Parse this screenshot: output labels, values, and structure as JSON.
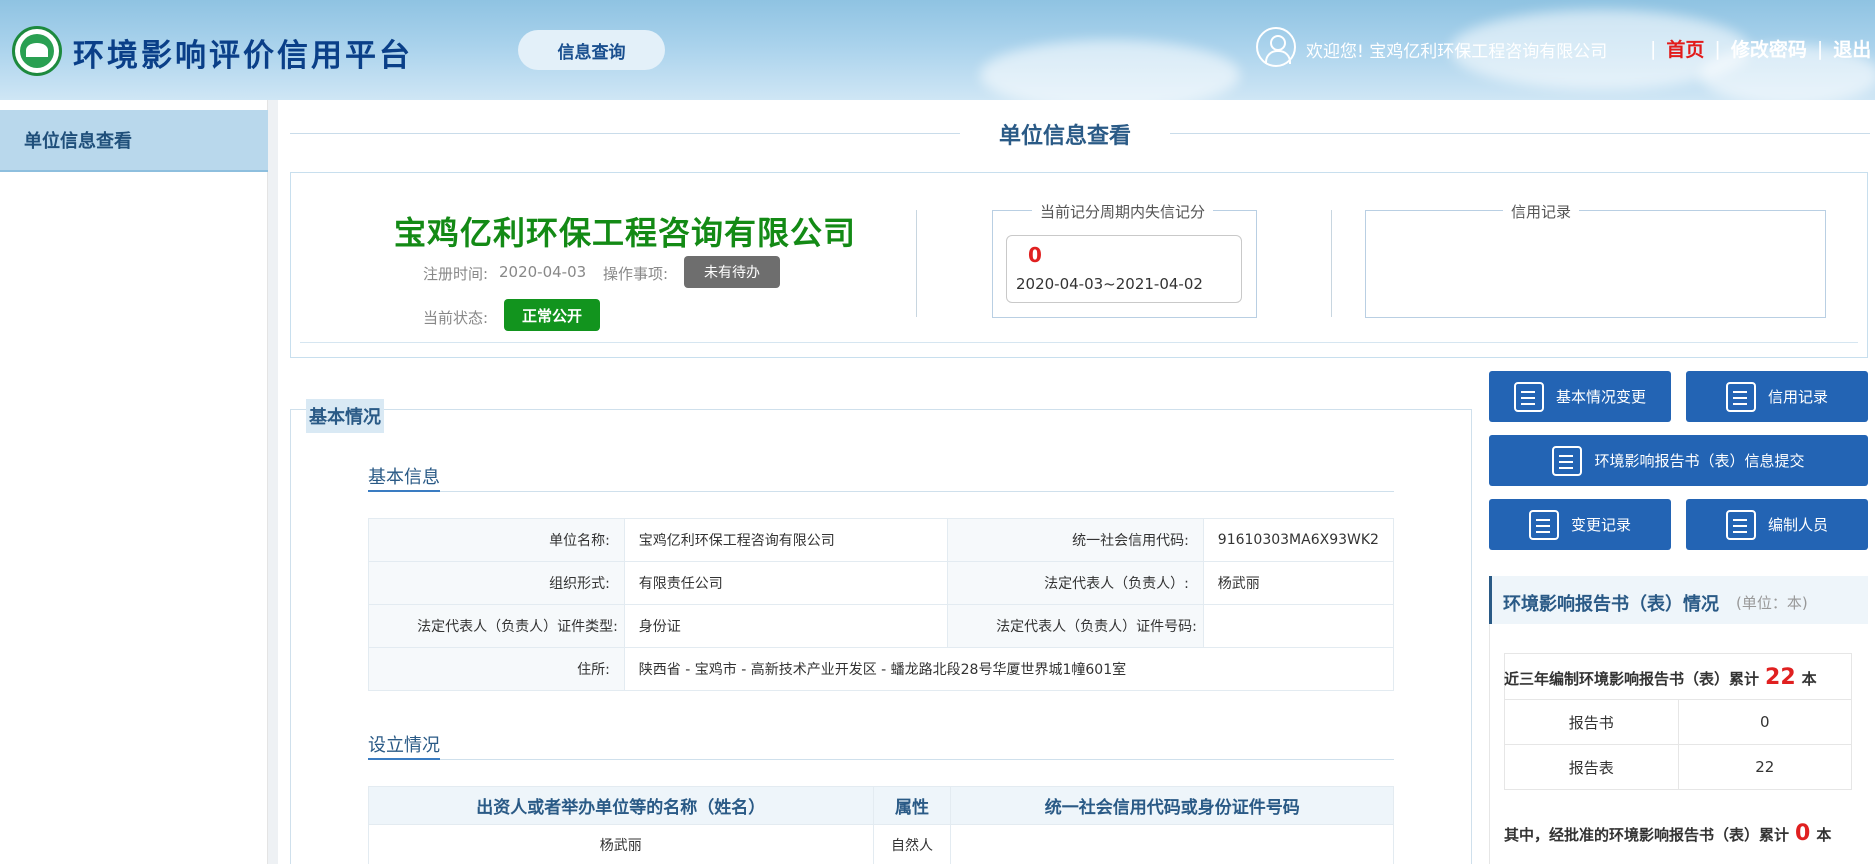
{
  "header": {
    "site_title": "环境影响评价信用平台",
    "query_button": "信息查询",
    "welcome": "欢迎您! 宝鸡亿利环保工程咨询有限公司",
    "nav_home": "首页",
    "nav_change_password": "修改密码",
    "nav_logout": "退出"
  },
  "sidebar": {
    "items": [
      {
        "label": "单位信息查看"
      }
    ]
  },
  "page": {
    "title": "单位信息查看"
  },
  "company": {
    "name": "宝鸡亿利环保工程咨询有限公司",
    "reg_label": "注册时间:",
    "reg_date": "2020-04-03",
    "op_label": "操作事项:",
    "pending": "未有待办",
    "status_label": "当前状态:",
    "status": "正常公开"
  },
  "score": {
    "legend": "当前记分周期内失信记分",
    "value": "0",
    "period": "2020-04-03~2021-04-02"
  },
  "credit": {
    "legend": "信用记录"
  },
  "basic": {
    "tab": "基本情况",
    "info_heading": "基本信息",
    "rows": [
      [
        "单位名称:",
        "宝鸡亿利环保工程咨询有限公司",
        "统一社会信用代码:",
        "91610303MA6X93WK2"
      ],
      [
        "组织形式:",
        "有限责任公司",
        "法定代表人（负责人）:",
        "杨武丽"
      ],
      [
        "法定代表人（负责人）证件类型:",
        "身份证",
        "法定代表人（负责人）证件号码:",
        ""
      ]
    ],
    "address_label": "住所:",
    "address": "陕西省 - 宝鸡市 - 高新技术产业开发区 - 蟠龙路北段28号华厦世界城1幢601室",
    "setup_heading": "设立情况",
    "invest_headers": [
      "出资人或者举办单位等的名称（姓名）",
      "属性",
      "统一社会信用代码或身份证件号码"
    ],
    "invest_rows": [
      [
        "杨武丽",
        "自然人",
        ""
      ]
    ]
  },
  "actions": {
    "basic_change": "基本情况变更",
    "credit_record": "信用记录",
    "report_submit": "环境影响报告书（表）信息提交",
    "change_record": "变更记录",
    "staff": "编制人员"
  },
  "report": {
    "title": "环境影响报告书（表）情况",
    "unit": "(单位：本)",
    "three_year_prefix": "近三年编制环境影响报告书（表）累计",
    "three_year_total": "22",
    "suffix": "本",
    "rows": [
      [
        "报告书",
        "0"
      ],
      [
        "报告表",
        "22"
      ]
    ],
    "approved_prefix": "其中，经批准的环境影响报告书（表）累计",
    "approved_total": "0"
  }
}
